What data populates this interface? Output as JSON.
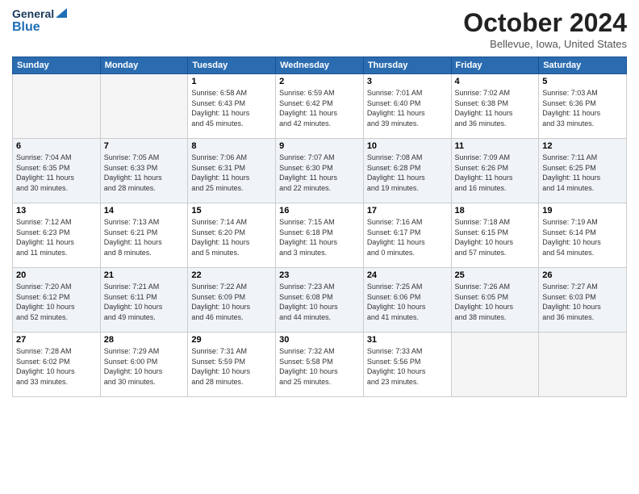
{
  "header": {
    "logo_general": "General",
    "logo_blue": "Blue",
    "month_title": "October 2024",
    "subtitle": "Bellevue, Iowa, United States"
  },
  "weekdays": [
    "Sunday",
    "Monday",
    "Tuesday",
    "Wednesday",
    "Thursday",
    "Friday",
    "Saturday"
  ],
  "rows": [
    [
      {
        "day": "",
        "empty": true
      },
      {
        "day": "",
        "empty": true
      },
      {
        "day": "1",
        "info": "Sunrise: 6:58 AM\nSunset: 6:43 PM\nDaylight: 11 hours\nand 45 minutes."
      },
      {
        "day": "2",
        "info": "Sunrise: 6:59 AM\nSunset: 6:42 PM\nDaylight: 11 hours\nand 42 minutes."
      },
      {
        "day": "3",
        "info": "Sunrise: 7:01 AM\nSunset: 6:40 PM\nDaylight: 11 hours\nand 39 minutes."
      },
      {
        "day": "4",
        "info": "Sunrise: 7:02 AM\nSunset: 6:38 PM\nDaylight: 11 hours\nand 36 minutes."
      },
      {
        "day": "5",
        "info": "Sunrise: 7:03 AM\nSunset: 6:36 PM\nDaylight: 11 hours\nand 33 minutes."
      }
    ],
    [
      {
        "day": "6",
        "info": "Sunrise: 7:04 AM\nSunset: 6:35 PM\nDaylight: 11 hours\nand 30 minutes."
      },
      {
        "day": "7",
        "info": "Sunrise: 7:05 AM\nSunset: 6:33 PM\nDaylight: 11 hours\nand 28 minutes."
      },
      {
        "day": "8",
        "info": "Sunrise: 7:06 AM\nSunset: 6:31 PM\nDaylight: 11 hours\nand 25 minutes."
      },
      {
        "day": "9",
        "info": "Sunrise: 7:07 AM\nSunset: 6:30 PM\nDaylight: 11 hours\nand 22 minutes."
      },
      {
        "day": "10",
        "info": "Sunrise: 7:08 AM\nSunset: 6:28 PM\nDaylight: 11 hours\nand 19 minutes."
      },
      {
        "day": "11",
        "info": "Sunrise: 7:09 AM\nSunset: 6:26 PM\nDaylight: 11 hours\nand 16 minutes."
      },
      {
        "day": "12",
        "info": "Sunrise: 7:11 AM\nSunset: 6:25 PM\nDaylight: 11 hours\nand 14 minutes."
      }
    ],
    [
      {
        "day": "13",
        "info": "Sunrise: 7:12 AM\nSunset: 6:23 PM\nDaylight: 11 hours\nand 11 minutes."
      },
      {
        "day": "14",
        "info": "Sunrise: 7:13 AM\nSunset: 6:21 PM\nDaylight: 11 hours\nand 8 minutes."
      },
      {
        "day": "15",
        "info": "Sunrise: 7:14 AM\nSunset: 6:20 PM\nDaylight: 11 hours\nand 5 minutes."
      },
      {
        "day": "16",
        "info": "Sunrise: 7:15 AM\nSunset: 6:18 PM\nDaylight: 11 hours\nand 3 minutes."
      },
      {
        "day": "17",
        "info": "Sunrise: 7:16 AM\nSunset: 6:17 PM\nDaylight: 11 hours\nand 0 minutes."
      },
      {
        "day": "18",
        "info": "Sunrise: 7:18 AM\nSunset: 6:15 PM\nDaylight: 10 hours\nand 57 minutes."
      },
      {
        "day": "19",
        "info": "Sunrise: 7:19 AM\nSunset: 6:14 PM\nDaylight: 10 hours\nand 54 minutes."
      }
    ],
    [
      {
        "day": "20",
        "info": "Sunrise: 7:20 AM\nSunset: 6:12 PM\nDaylight: 10 hours\nand 52 minutes."
      },
      {
        "day": "21",
        "info": "Sunrise: 7:21 AM\nSunset: 6:11 PM\nDaylight: 10 hours\nand 49 minutes."
      },
      {
        "day": "22",
        "info": "Sunrise: 7:22 AM\nSunset: 6:09 PM\nDaylight: 10 hours\nand 46 minutes."
      },
      {
        "day": "23",
        "info": "Sunrise: 7:23 AM\nSunset: 6:08 PM\nDaylight: 10 hours\nand 44 minutes."
      },
      {
        "day": "24",
        "info": "Sunrise: 7:25 AM\nSunset: 6:06 PM\nDaylight: 10 hours\nand 41 minutes."
      },
      {
        "day": "25",
        "info": "Sunrise: 7:26 AM\nSunset: 6:05 PM\nDaylight: 10 hours\nand 38 minutes."
      },
      {
        "day": "26",
        "info": "Sunrise: 7:27 AM\nSunset: 6:03 PM\nDaylight: 10 hours\nand 36 minutes."
      }
    ],
    [
      {
        "day": "27",
        "info": "Sunrise: 7:28 AM\nSunset: 6:02 PM\nDaylight: 10 hours\nand 33 minutes."
      },
      {
        "day": "28",
        "info": "Sunrise: 7:29 AM\nSunset: 6:00 PM\nDaylight: 10 hours\nand 30 minutes."
      },
      {
        "day": "29",
        "info": "Sunrise: 7:31 AM\nSunset: 5:59 PM\nDaylight: 10 hours\nand 28 minutes."
      },
      {
        "day": "30",
        "info": "Sunrise: 7:32 AM\nSunset: 5:58 PM\nDaylight: 10 hours\nand 25 minutes."
      },
      {
        "day": "31",
        "info": "Sunrise: 7:33 AM\nSunset: 5:56 PM\nDaylight: 10 hours\nand 23 minutes."
      },
      {
        "day": "",
        "empty": true
      },
      {
        "day": "",
        "empty": true
      }
    ]
  ]
}
